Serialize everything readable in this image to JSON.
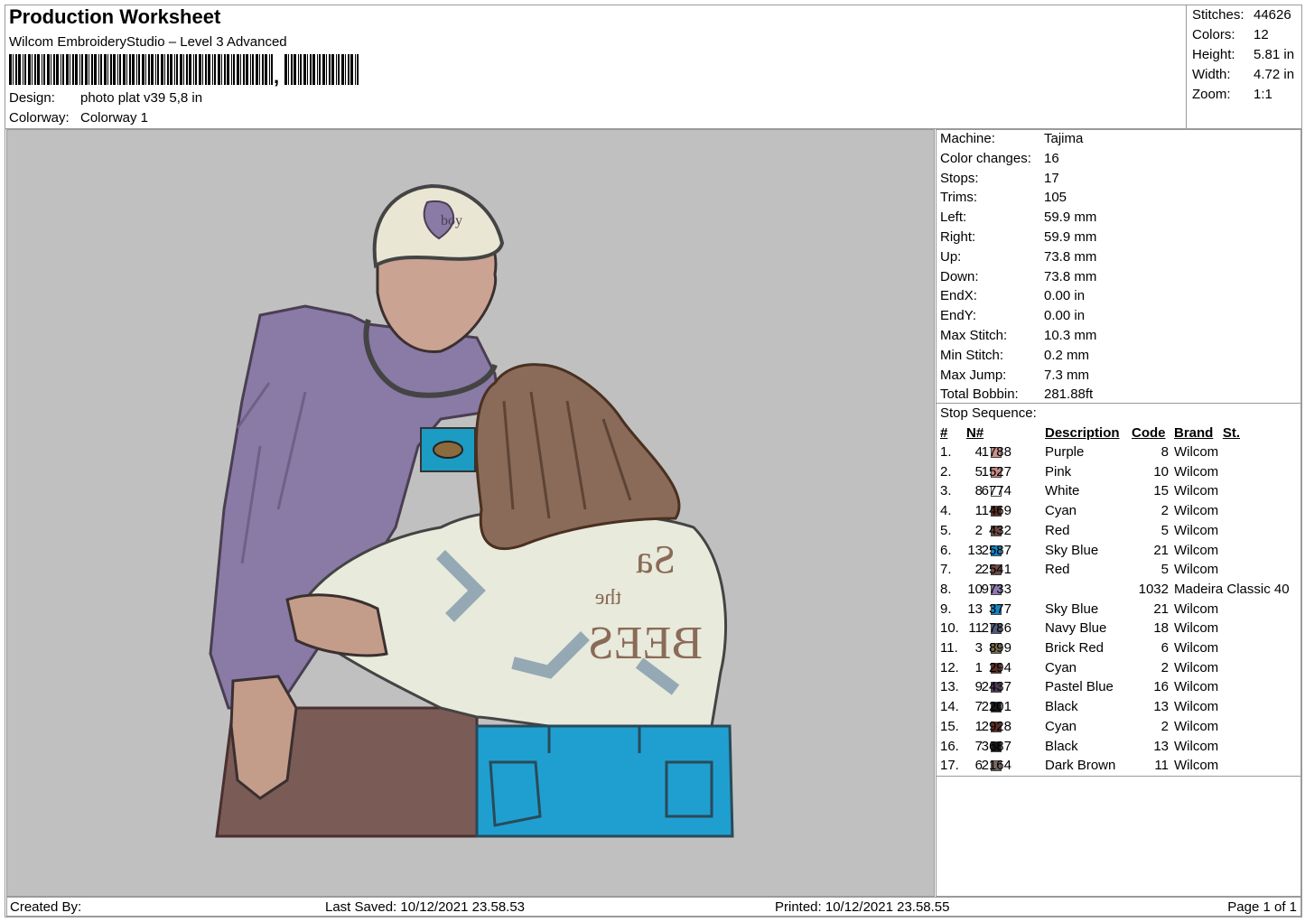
{
  "header": {
    "title": "Production Worksheet",
    "software": "Wilcom EmbroideryStudio – Level 3 Advanced",
    "barcode_suffix": ",",
    "design_label": "Design:",
    "design_value": "photo plat v39 5,8 in",
    "colorway_label": "Colorway:",
    "colorway_value": "Colorway 1"
  },
  "summary": [
    {
      "label": "Stitches:",
      "value": "44626"
    },
    {
      "label": "Colors:",
      "value": "12"
    },
    {
      "label": "Height:",
      "value": "5.81 in"
    },
    {
      "label": "Width:",
      "value": "4.72 in"
    },
    {
      "label": "Zoom:",
      "value": "1:1"
    }
  ],
  "machine_info": [
    {
      "label": "Machine:",
      "value": "Tajima"
    },
    {
      "label": "Color changes:",
      "value": "16"
    },
    {
      "label": "Stops:",
      "value": "17"
    },
    {
      "label": "Trims:",
      "value": "105"
    },
    {
      "label": "Left:",
      "value": "59.9 mm"
    },
    {
      "label": "Right:",
      "value": "59.9 mm"
    },
    {
      "label": "Up:",
      "value": "73.8 mm"
    },
    {
      "label": "Down:",
      "value": "73.8 mm"
    },
    {
      "label": "EndX:",
      "value": "0.00 in"
    },
    {
      "label": "EndY:",
      "value": "0.00 in"
    },
    {
      "label": "Max Stitch:",
      "value": "10.3 mm"
    },
    {
      "label": "Min Stitch:",
      "value": "0.2 mm"
    },
    {
      "label": "Max Jump:",
      "value": "7.3 mm"
    },
    {
      "label": "Total Bobbin:",
      "value": "281.88ft"
    }
  ],
  "stop_sequence": {
    "title": "Stop Sequence:",
    "columns": [
      "#",
      "N#",
      "St.",
      "Description",
      "Code",
      "Brand"
    ],
    "rows": [
      {
        "idx": "1.",
        "n": "4",
        "color": "#c9938c",
        "st": "1788",
        "desc": "Purple",
        "code": "8",
        "brand": "Wilcom"
      },
      {
        "idx": "2.",
        "n": "5",
        "color": "#c98a88",
        "st": "1527",
        "desc": "Pink",
        "code": "10",
        "brand": "Wilcom"
      },
      {
        "idx": "3.",
        "n": "8",
        "color": "#ffffff",
        "st": "6774",
        "desc": "White",
        "code": "15",
        "brand": "Wilcom"
      },
      {
        "idx": "4.",
        "n": "1",
        "color": "#5a2e24",
        "st": "1469",
        "desc": "Cyan",
        "code": "2",
        "brand": "Wilcom"
      },
      {
        "idx": "5.",
        "n": "2",
        "color": "#6e4843",
        "st": "432",
        "desc": "Red",
        "code": "5",
        "brand": "Wilcom"
      },
      {
        "idx": "6.",
        "n": "13",
        "color": "#1287c8",
        "st": "2587",
        "desc": "Sky Blue",
        "code": "21",
        "brand": "Wilcom"
      },
      {
        "idx": "7.",
        "n": "2",
        "color": "#6e4843",
        "st": "2541",
        "desc": "Red",
        "code": "5",
        "brand": "Wilcom"
      },
      {
        "idx": "8.",
        "n": "10",
        "color": "#8f7ab0",
        "st": "9733",
        "desc": "",
        "code": "1032",
        "brand": "Madeira Classic 40"
      },
      {
        "idx": "9.",
        "n": "13",
        "color": "#1287c8",
        "st": "377",
        "desc": "Sky Blue",
        "code": "21",
        "brand": "Wilcom"
      },
      {
        "idx": "10.",
        "n": "11",
        "color": "#525a7a",
        "st": "2786",
        "desc": "Navy Blue",
        "code": "18",
        "brand": "Wilcom"
      },
      {
        "idx": "11.",
        "n": "3",
        "color": "#7a6a50",
        "st": "899",
        "desc": "Brick Red",
        "code": "6",
        "brand": "Wilcom"
      },
      {
        "idx": "12.",
        "n": "1",
        "color": "#5a2e24",
        "st": "294",
        "desc": "Cyan",
        "code": "2",
        "brand": "Wilcom"
      },
      {
        "idx": "13.",
        "n": "9",
        "color": "#4a3a55",
        "st": "2437",
        "desc": "Pastel Blue",
        "code": "16",
        "brand": "Wilcom"
      },
      {
        "idx": "14.",
        "n": "7",
        "color": "#1a1a1a",
        "st": "2201",
        "desc": "Black",
        "code": "13",
        "brand": "Wilcom"
      },
      {
        "idx": "15.",
        "n": "1",
        "color": "#5a2e24",
        "st": "2928",
        "desc": "Cyan",
        "code": "2",
        "brand": "Wilcom"
      },
      {
        "idx": "16.",
        "n": "7",
        "color": "#1a1a1a",
        "st": "3687",
        "desc": "Black",
        "code": "13",
        "brand": "Wilcom"
      },
      {
        "idx": "17.",
        "n": "6",
        "color": "#7a6a62",
        "st": "2164",
        "desc": "Dark Brown",
        "code": "11",
        "brand": "Wilcom"
      }
    ]
  },
  "design_art": {
    "cap_text": "boy",
    "shirt_text_1": "Sa",
    "shirt_text_2": "the",
    "shirt_text_3": "BEES"
  },
  "footer": {
    "created_by": "Created By:",
    "last_saved": "Last Saved: 10/12/2021 23.58.53",
    "printed": "Printed: 10/12/2021 23.58.55",
    "page": "Page 1 of 1"
  }
}
